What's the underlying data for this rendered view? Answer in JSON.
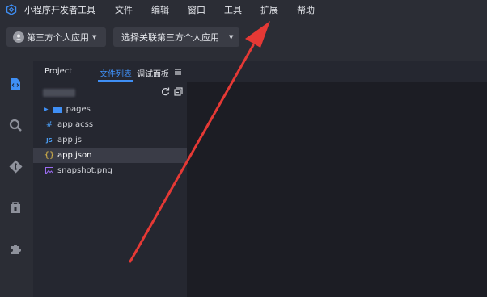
{
  "menubar": {
    "app_name": "小程序开发者工具",
    "items": [
      "文件",
      "编辑",
      "窗口",
      "工具",
      "扩展",
      "帮助"
    ]
  },
  "toolbar": {
    "account_label": "第三方个人应用",
    "link_select_label": "选择关联第三方个人应用"
  },
  "sidebar": {
    "tabs": {
      "project": "Project",
      "files": "文件列表",
      "debug": "调试面板"
    },
    "tree": [
      {
        "icon": "folder-icon",
        "label": "pages"
      },
      {
        "icon": "hash-icon",
        "label": "app.acss"
      },
      {
        "icon": "js-icon",
        "label": "app.js"
      },
      {
        "icon": "braces-icon",
        "label": "app.json",
        "selected": true
      },
      {
        "icon": "image-icon",
        "label": "snapshot.png"
      }
    ]
  },
  "colors": {
    "accent": "#3f8ff5",
    "arrow": "#e53935",
    "menubar_bg": "#2b2d35",
    "editor_bg": "#1c1d24"
  }
}
